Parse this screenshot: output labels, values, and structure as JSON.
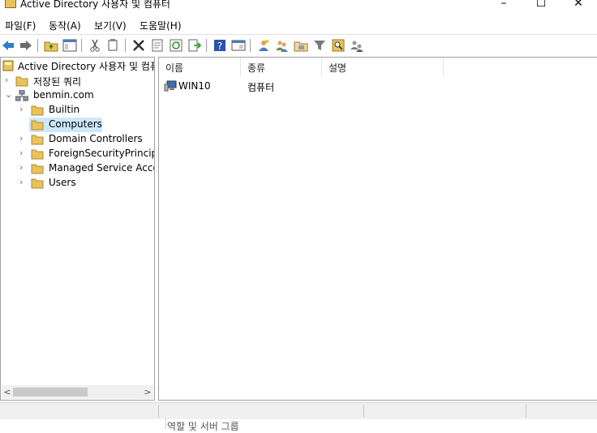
{
  "window": {
    "title": "Active Directory 사용자 및 컴퓨터",
    "minimize": "–",
    "maximize": "☐",
    "close": "✕"
  },
  "menu": [
    {
      "label": "파일(F)"
    },
    {
      "label": "동작(A)"
    },
    {
      "label": "보기(V)"
    },
    {
      "label": "도움말(H)"
    }
  ],
  "toolbar": [
    "back-arrow-icon",
    "forward-arrow-icon",
    "up-folder-icon",
    "show-hide-tree-icon",
    "cut-icon",
    "copy-icon",
    "delete-icon",
    "properties-icon",
    "refresh-icon",
    "export-list-icon",
    "help-icon",
    "console-view-icon",
    "new-user-icon",
    "new-group-icon",
    "new-ou-icon",
    "filter-icon",
    "find-icon",
    "add-to-group-icon"
  ],
  "tree": {
    "root": "Active Directory 사용자 및 컴퓨터",
    "saved_queries": "저장된 쿼리",
    "domain": "benmin.com",
    "children": [
      {
        "label": "Builtin"
      },
      {
        "label": "Computers",
        "selected": true
      },
      {
        "label": "Domain Controllers"
      },
      {
        "label": "ForeignSecurityPrincipals"
      },
      {
        "label": "Managed Service Accounts"
      },
      {
        "label": "Users"
      }
    ]
  },
  "list": {
    "columns": [
      "이름",
      "종류",
      "설명"
    ],
    "rows": [
      {
        "name": "WIN10",
        "type": "컴퓨터",
        "description": ""
      }
    ]
  },
  "scroll": {
    "left": "<",
    "right": ">"
  },
  "below_text": "역할 및 서버 그룹",
  "colors": {
    "selection": "#cce8ff",
    "folder": "#e8c35a",
    "border": "#a0a0a0"
  }
}
